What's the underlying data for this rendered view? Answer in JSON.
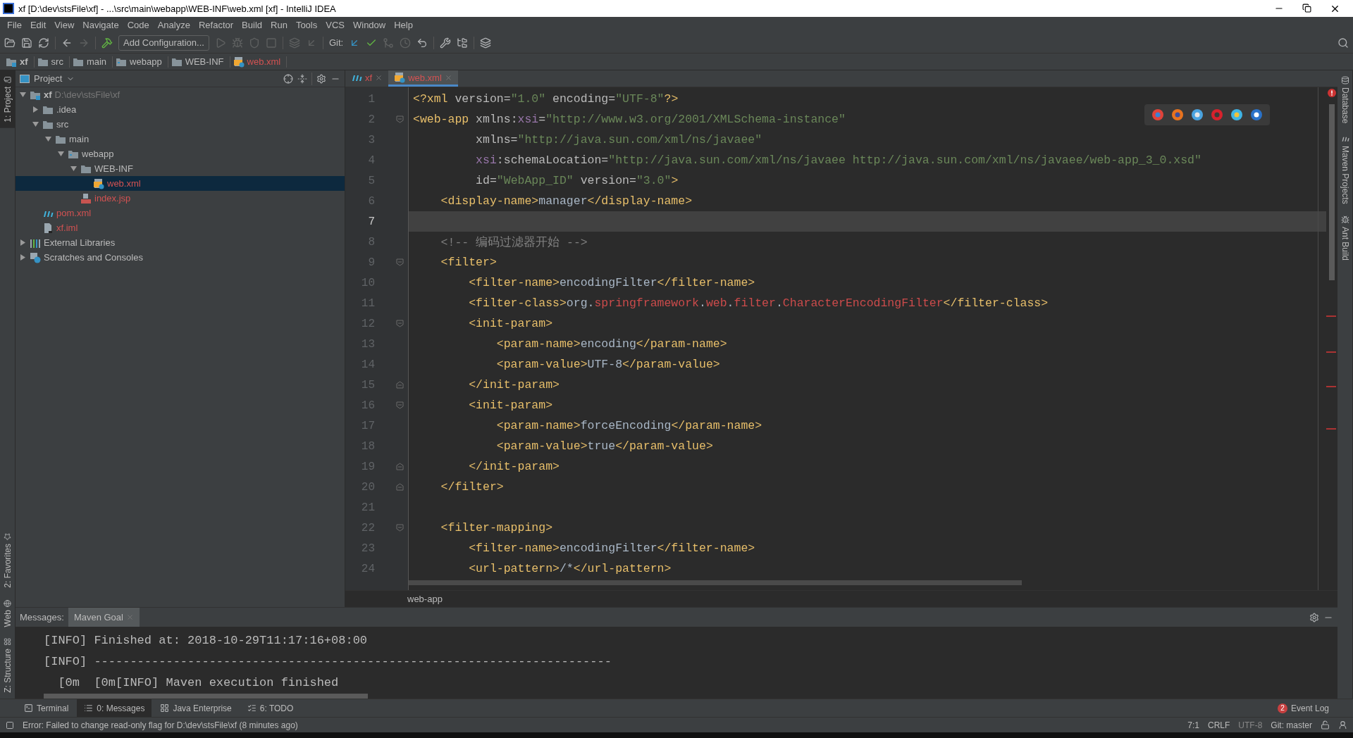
{
  "window": {
    "title": "xf [D:\\dev\\stsFile\\xf] - ...\\src\\main\\webapp\\WEB-INF\\web.xml [xf] - IntelliJ IDEA"
  },
  "menu": [
    "File",
    "Edit",
    "View",
    "Navigate",
    "Code",
    "Analyze",
    "Refactor",
    "Build",
    "Run",
    "Tools",
    "VCS",
    "Window",
    "Help"
  ],
  "toolbar": {
    "config_button": "Add Configuration...",
    "git_label": "Git:"
  },
  "breadcrumbs": [
    {
      "label": "xf",
      "kind": "project"
    },
    {
      "label": "src",
      "kind": "folder"
    },
    {
      "label": "main",
      "kind": "folder"
    },
    {
      "label": "webapp",
      "kind": "web-folder"
    },
    {
      "label": "WEB-INF",
      "kind": "folder"
    },
    {
      "label": "web.xml",
      "kind": "xml"
    }
  ],
  "left_stripe": {
    "top": [
      {
        "label": "1: Project",
        "selected": true
      }
    ],
    "bottom": [
      {
        "label": "2: Favorites",
        "selected": false
      },
      {
        "label": "Web",
        "selected": false
      },
      {
        "label": "Z: Structure",
        "selected": false
      }
    ]
  },
  "right_stripe": [
    {
      "label": "Database",
      "kind": "database"
    },
    {
      "label": "Maven Projects",
      "kind": "maven"
    },
    {
      "label": "Ant Build",
      "kind": "ant"
    }
  ],
  "project_panel": {
    "title": "Project",
    "tree": [
      {
        "label": "xf",
        "path": "D:\\dev\\stsFile\\xf",
        "kind": "project",
        "expanded": true,
        "selected": false,
        "color": "#bbbbbb",
        "children": [
          {
            "label": ".idea",
            "kind": "folder",
            "expanded": false,
            "selected": false,
            "color": "#bbbbbb"
          },
          {
            "label": "src",
            "kind": "folder",
            "expanded": true,
            "selected": false,
            "color": "#bbbbbb",
            "children": [
              {
                "label": "main",
                "kind": "folder",
                "expanded": true,
                "selected": false,
                "color": "#bbbbbb",
                "children": [
                  {
                    "label": "webapp",
                    "kind": "web-folder",
                    "expanded": true,
                    "selected": false,
                    "color": "#bbbbbb",
                    "children": [
                      {
                        "label": "WEB-INF",
                        "kind": "folder",
                        "expanded": true,
                        "selected": false,
                        "color": "#bbbbbb",
                        "children": [
                          {
                            "label": "web.xml",
                            "kind": "xml",
                            "selected": true,
                            "color": "#d25252"
                          }
                        ]
                      },
                      {
                        "label": "index.jsp",
                        "kind": "jsp",
                        "selected": false,
                        "color": "#d25252"
                      }
                    ]
                  }
                ]
              }
            ]
          },
          {
            "label": "pom.xml",
            "kind": "maven",
            "selected": false,
            "color": "#d25252"
          },
          {
            "label": "xf.iml",
            "kind": "iml",
            "selected": false,
            "color": "#d25252"
          }
        ]
      },
      {
        "label": "External Libraries",
        "kind": "libraries",
        "expanded": false,
        "selected": false,
        "color": "#bbbbbb"
      },
      {
        "label": "Scratches and Consoles",
        "kind": "scratches",
        "expanded": false,
        "selected": false,
        "color": "#bbbbbb"
      }
    ]
  },
  "editor": {
    "tabs": [
      {
        "label": "xf",
        "kind": "maven",
        "selected": false
      },
      {
        "label": "web.xml",
        "kind": "xml",
        "selected": true
      }
    ],
    "lines": [
      {
        "number": "1",
        "kind": "plain",
        "current": false,
        "tokens": [
          {
            "kind": "tag",
            "text": "<?xml"
          },
          {
            "kind": "attr",
            "text": " version="
          },
          {
            "kind": "str",
            "text": "\"1.0\""
          },
          {
            "kind": "attr",
            "text": " encoding="
          },
          {
            "kind": "str",
            "text": "\"UTF-8\""
          },
          {
            "kind": "tag",
            "text": "?>"
          }
        ]
      },
      {
        "number": "2",
        "kind": "opener",
        "current": false,
        "tokens": [
          {
            "kind": "tag",
            "text": "<web-app"
          },
          {
            "kind": "attr",
            "text": " xmlns:"
          },
          {
            "kind": "ns",
            "text": "xsi"
          },
          {
            "kind": "attr",
            "text": "="
          },
          {
            "kind": "str",
            "text": "\"http://www.w3.org/2001/XMLSchema-instance\""
          }
        ]
      },
      {
        "number": "3",
        "kind": "plain",
        "current": false,
        "tokens": [
          {
            "kind": "attr",
            "text": "         xmlns="
          },
          {
            "kind": "str",
            "text": "\"http://java.sun.com/xml/ns/javaee\""
          }
        ]
      },
      {
        "number": "4",
        "kind": "plain",
        "current": false,
        "tokens": [
          {
            "kind": "ns",
            "text": "         xsi"
          },
          {
            "kind": "attr",
            "text": ":schemaLocation="
          },
          {
            "kind": "str",
            "text": "\"http://java.sun.com/xml/ns/javaee http://java.sun.com/xml/ns/javaee/web-app_3_0.xsd\""
          }
        ]
      },
      {
        "number": "5",
        "kind": "plain",
        "current": false,
        "tokens": [
          {
            "kind": "attr",
            "text": "         id="
          },
          {
            "kind": "str",
            "text": "\"WebApp_ID\""
          },
          {
            "kind": "attr",
            "text": " version="
          },
          {
            "kind": "str",
            "text": "\"3.0\""
          },
          {
            "kind": "tag",
            "text": ">"
          }
        ]
      },
      {
        "number": "6",
        "kind": "plain",
        "current": false,
        "tokens": [
          {
            "kind": "tag",
            "text": "    <display-name>"
          },
          {
            "kind": "text",
            "text": "manager"
          },
          {
            "kind": "tag",
            "text": "</display-name>"
          }
        ]
      },
      {
        "number": "7",
        "kind": "plain",
        "current": true
      },
      {
        "number": "8",
        "kind": "plain",
        "current": false,
        "tokens": [
          {
            "kind": "comment",
            "text": "    <!-- 编码过滤器开始 -->"
          }
        ]
      },
      {
        "number": "9",
        "kind": "opener",
        "current": false,
        "tokens": [
          {
            "kind": "tag",
            "text": "    <filter>"
          }
        ]
      },
      {
        "number": "10",
        "kind": "plain",
        "current": false,
        "tokens": [
          {
            "kind": "tag",
            "text": "        <filter-name>"
          },
          {
            "kind": "text",
            "text": "encodingFilter"
          },
          {
            "kind": "tag",
            "text": "</filter-name>"
          }
        ]
      },
      {
        "number": "11",
        "kind": "plain",
        "current": false,
        "tokens": [
          {
            "kind": "tag",
            "text": "        <filter-class>"
          },
          {
            "kind": "text",
            "text": "org."
          },
          {
            "kind": "ref",
            "text": "springframework"
          },
          {
            "kind": "text",
            "text": "."
          },
          {
            "kind": "ref",
            "text": "web"
          },
          {
            "kind": "text",
            "text": "."
          },
          {
            "kind": "ref",
            "text": "filter"
          },
          {
            "kind": "text",
            "text": "."
          },
          {
            "kind": "ref",
            "text": "CharacterEncodingFilter"
          },
          {
            "kind": "tag",
            "text": "</filter-class>"
          }
        ]
      },
      {
        "number": "12",
        "kind": "opener",
        "current": false,
        "tokens": [
          {
            "kind": "tag",
            "text": "        <init-param>"
          }
        ]
      },
      {
        "number": "13",
        "kind": "plain",
        "current": false,
        "tokens": [
          {
            "kind": "tag",
            "text": "            <param-name>"
          },
          {
            "kind": "text",
            "text": "encoding"
          },
          {
            "kind": "tag",
            "text": "</param-name>"
          }
        ]
      },
      {
        "number": "14",
        "kind": "plain",
        "current": false,
        "tokens": [
          {
            "kind": "tag",
            "text": "            <param-value>"
          },
          {
            "kind": "text",
            "text": "UTF-8"
          },
          {
            "kind": "tag",
            "text": "</param-value>"
          }
        ]
      },
      {
        "number": "15",
        "kind": "closer",
        "current": false,
        "tokens": [
          {
            "kind": "tag",
            "text": "        </init-param>"
          }
        ]
      },
      {
        "number": "16",
        "kind": "opener",
        "current": false,
        "tokens": [
          {
            "kind": "tag",
            "text": "        <init-param>"
          }
        ]
      },
      {
        "number": "17",
        "kind": "plain",
        "current": false,
        "tokens": [
          {
            "kind": "tag",
            "text": "            <param-name>"
          },
          {
            "kind": "text",
            "text": "forceEncoding"
          },
          {
            "kind": "tag",
            "text": "</param-name>"
          }
        ]
      },
      {
        "number": "18",
        "kind": "plain",
        "current": false,
        "tokens": [
          {
            "kind": "tag",
            "text": "            <param-value>"
          },
          {
            "kind": "text",
            "text": "true"
          },
          {
            "kind": "tag",
            "text": "</param-value>"
          }
        ]
      },
      {
        "number": "19",
        "kind": "closer",
        "current": false,
        "tokens": [
          {
            "kind": "tag",
            "text": "        </init-param>"
          }
        ]
      },
      {
        "number": "20",
        "kind": "closer",
        "current": false,
        "tokens": [
          {
            "kind": "tag",
            "text": "    </filter>"
          }
        ]
      },
      {
        "number": "21",
        "kind": "plain",
        "current": false
      },
      {
        "number": "22",
        "kind": "opener",
        "current": false,
        "tokens": [
          {
            "kind": "tag",
            "text": "    <filter-mapping>"
          }
        ]
      },
      {
        "number": "23",
        "kind": "plain",
        "current": false,
        "tokens": [
          {
            "kind": "tag",
            "text": "        <filter-name>"
          },
          {
            "kind": "text",
            "text": "encodingFilter"
          },
          {
            "kind": "tag",
            "text": "</filter-name>"
          }
        ]
      },
      {
        "number": "24",
        "kind": "plain",
        "current": false,
        "tokens": [
          {
            "kind": "tag",
            "text": "        <url-pattern>"
          },
          {
            "kind": "text",
            "text": "/*"
          },
          {
            "kind": "tag",
            "text": "</url-pattern>"
          }
        ]
      }
    ],
    "breadcrumb": "web-app"
  },
  "messages_panel": {
    "label": "Messages:",
    "tabs": [
      {
        "label": "Maven Goal",
        "selected": true
      }
    ],
    "lines": [
      "[INFO] Finished at: 2018-10-29T11:17:16+08:00",
      "[INFO] ------------------------------------------------------------------------",
      "  [0m  [0m[INFO] Maven execution finished"
    ]
  },
  "tool_tabs": [
    {
      "label": "Terminal",
      "kind": "terminal",
      "selected": false
    },
    {
      "label": "0: Messages",
      "kind": "messages",
      "selected": true
    },
    {
      "label": "Java Enterprise",
      "kind": "enterprise",
      "selected": false
    },
    {
      "label": "6: TODO",
      "kind": "todo",
      "selected": false
    }
  ],
  "event_log": {
    "count": "2",
    "label": "Event Log"
  },
  "status_bar": {
    "message": "Error: Failed to change read-only flag for D:\\dev\\stsFile\\xf (8 minutes ago)",
    "position": "7:1",
    "line_separator": "CRLF",
    "encoding": "UTF-8",
    "branch": "Git: master"
  }
}
